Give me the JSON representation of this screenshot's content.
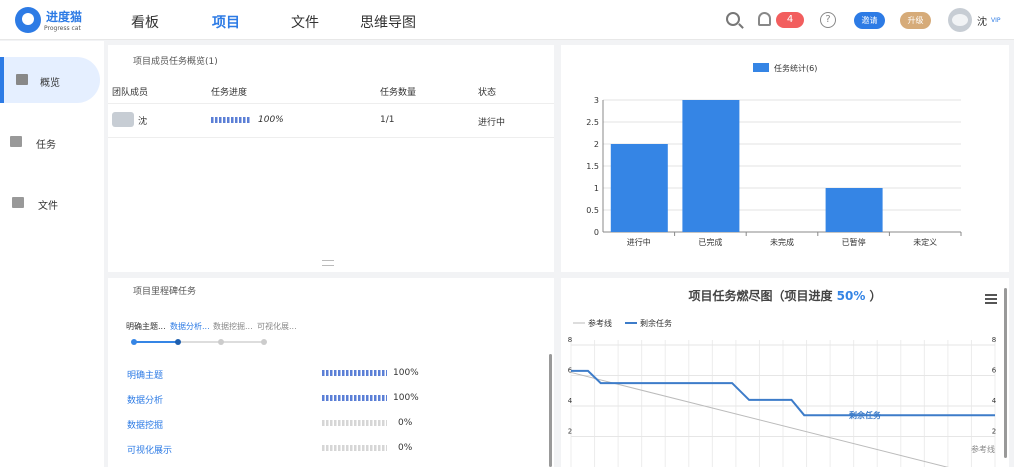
{
  "header": {
    "logo_title": "进度猫",
    "logo_subtitle": "Progress cat",
    "nav": [
      {
        "label": "看板",
        "active": false
      },
      {
        "label": "项目",
        "active": true
      },
      {
        "label": "文件",
        "active": false
      },
      {
        "label": "思维导图",
        "active": false
      }
    ],
    "notification_count": "4",
    "help_glyph": "?",
    "invite_label": "邀请",
    "upgrade_label": "升级",
    "user_name": "沈",
    "vip_label": "VIP"
  },
  "sidebar": {
    "items": [
      {
        "label": "概览",
        "icon": "dashboard-icon",
        "active": true
      },
      {
        "label": "任务",
        "icon": "task-icon",
        "active": false
      },
      {
        "label": "文件",
        "icon": "folder-icon",
        "active": false
      }
    ]
  },
  "members_panel": {
    "title": "项目成员任务概览(1)",
    "columns": [
      "团队成员",
      "任务进度",
      "任务数量",
      "状态"
    ],
    "rows": [
      {
        "name": "沈",
        "progress_text": "100%",
        "progress": 1.0,
        "count": "1/1",
        "status": "进行中"
      }
    ]
  },
  "milestone_panel": {
    "title": "项目里程碑任务",
    "steps": [
      "明确主题...",
      "数据分析...",
      "数据挖掘...",
      "可视化展..."
    ],
    "current_step": 1,
    "rows": [
      {
        "label": "明确主题",
        "value": "100%",
        "progress": 1.0
      },
      {
        "label": "数据分析",
        "value": "100%",
        "progress": 1.0
      },
      {
        "label": "数据挖掘",
        "value": "0%",
        "progress": 0.0
      },
      {
        "label": "可视化展示",
        "value": "0%",
        "progress": 0.0
      }
    ]
  },
  "chart_data": [
    {
      "type": "bar",
      "legend": "任务统计(6)",
      "categories": [
        "进行中",
        "已完成",
        "未完成",
        "已暂停",
        "未定义"
      ],
      "values": [
        2,
        3,
        0,
        1,
        0
      ],
      "yticks": [
        "0",
        "0.5",
        "1",
        "1.5",
        "2",
        "2.5",
        "3"
      ],
      "ylim": [
        0,
        3
      ],
      "legend_position": "top",
      "color": "#3585e5",
      "grid": true
    },
    {
      "type": "line",
      "title": "项目任务燃尽图（项目进度",
      "title_highlight": "50%",
      "title_suffix": "）",
      "series": [
        {
          "name": "参考线",
          "color": "#bbbbbb"
        },
        {
          "name": "剩余任务",
          "color": "#3d7cc9"
        }
      ],
      "reference_line": [
        6.2,
        -0.8
      ],
      "remaining": [
        [
          0,
          6.3
        ],
        [
          0.04,
          6.3
        ],
        [
          0.07,
          5.5
        ],
        [
          0.38,
          5.5
        ],
        [
          0.42,
          4.4
        ],
        [
          0.52,
          4.4
        ],
        [
          0.55,
          3.4
        ],
        [
          1.0,
          3.4
        ]
      ],
      "remaining_label": "剩余任务",
      "reference_label": "参考线",
      "yticks": [
        "2",
        "4",
        "6",
        "8"
      ],
      "ylim": [
        0,
        8
      ],
      "grid": true,
      "legend_position": "top-left"
    }
  ],
  "menu_icon": "hamburger-menu-icon"
}
